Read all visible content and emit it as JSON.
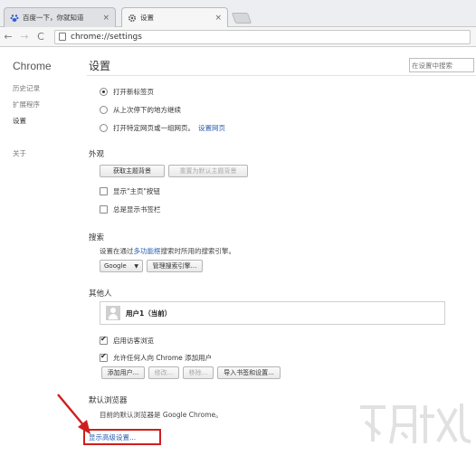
{
  "tabs": [
    {
      "label": "百度一下，你就知道",
      "icon": "baidu-paw-icon"
    },
    {
      "label": "设置",
      "icon": "gear-icon"
    }
  ],
  "toolbar": {
    "url": "chrome://settings"
  },
  "nav": {
    "brand": "Chrome",
    "items": [
      "历史记录",
      "扩展程序",
      "设置",
      "关于"
    ]
  },
  "settings": {
    "title": "设置",
    "search_placeholder": "在设置中搜索",
    "startup": {
      "options": [
        "打开新标签页",
        "从上次停下的地方继续",
        "打开特定网页或一组网页。"
      ],
      "link": "设置网页"
    },
    "appearance": {
      "heading": "外观",
      "get_themes": "获取主题背景",
      "reset_theme": "重置为默认主题背景",
      "show_home": "显示\"主页\"按钮",
      "show_bookmarks": "总是显示书签栏"
    },
    "search": {
      "heading": "搜索",
      "desc_pre": "设置在通过",
      "desc_link": "多功能框",
      "desc_post": "搜索时所用的搜索引擎。",
      "engine": "Google",
      "manage": "管理搜索引擎..."
    },
    "people": {
      "heading": "其他人",
      "user": "用户1（当前）",
      "guest": "启用访客浏览",
      "anyone_add": "允许任何人向 Chrome 添加用户",
      "add_user": "添加用户...",
      "edit": "修改...",
      "remove": "移除...",
      "import": "导入书签和设置..."
    },
    "default_browser": {
      "heading": "默认浏览器",
      "desc": "目前的默认浏览器是 Google Chrome。"
    },
    "advanced_link": "显示高级设置..."
  },
  "annotation_color": "#d01e1e",
  "watermark": {
    "text": "www.xz7.com"
  }
}
